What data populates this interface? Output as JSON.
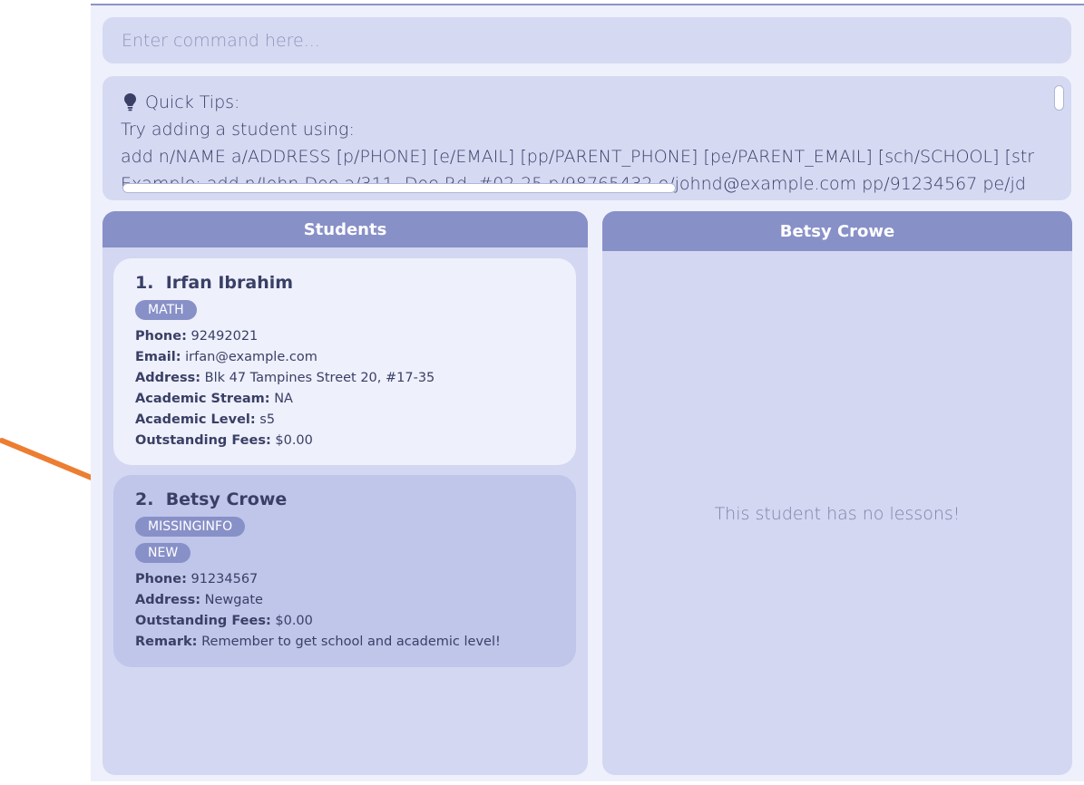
{
  "command": {
    "placeholder": "Enter command here..."
  },
  "result": {
    "tips_title": "Quick Tips:",
    "line1": "Try adding a student using:",
    "line2": "add n/NAME a/ADDRESS [p/PHONE] [e/EMAIL] [pp/PARENT_PHONE] [pe/PARENT_EMAIL] [sch/SCHOOL] [str",
    "line3": "Example: add n/John Doe a/311, Doe Rd, #02-25 p/98765432 e/johnd@example.com pp/91234567 pe/jd"
  },
  "students_panel": {
    "title": "Students",
    "students": [
      {
        "index": "1.",
        "name": "Irfan Ibrahim",
        "tags": [
          "MATH"
        ],
        "fields": [
          {
            "label": "Phone:",
            "value": "92492021"
          },
          {
            "label": "Email:",
            "value": "irfan@example.com"
          },
          {
            "label": "Address:",
            "value": "Blk 47 Tampines Street 20, #17-35"
          },
          {
            "label": "Academic Stream:",
            "value": "NA"
          },
          {
            "label": "Academic Level:",
            "value": "s5"
          },
          {
            "label": "Outstanding Fees:",
            "value": "$0.00"
          }
        ]
      },
      {
        "index": "2.",
        "name": "Betsy Crowe",
        "tags": [
          "MISSINGINFO",
          "NEW"
        ],
        "fields": [
          {
            "label": "Phone:",
            "value": "91234567"
          },
          {
            "label": "Address:",
            "value": "Newgate"
          },
          {
            "label": "Outstanding Fees:",
            "value": "$0.00"
          },
          {
            "label": "Remark:",
            "value": "Remember to get school and academic level!"
          }
        ]
      }
    ]
  },
  "detail_panel": {
    "title": "Betsy Crowe",
    "empty_message": "This student has no lessons!"
  },
  "colors": {
    "accent": "#8890c8",
    "panel_bg": "#d3d7f1",
    "selected_card": "#bfc6ea",
    "arrow": "#ed7d31"
  },
  "icons": {
    "tips": "lightbulb-icon",
    "pointer": "arrow-annotation"
  }
}
